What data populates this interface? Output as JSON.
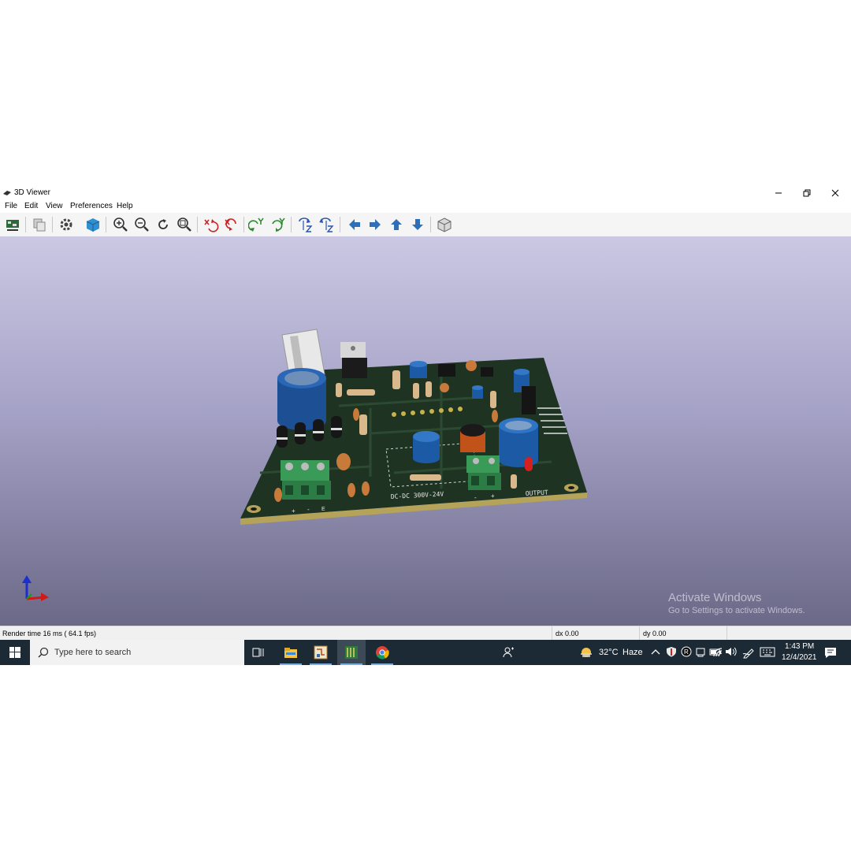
{
  "window": {
    "title": "3D Viewer",
    "menu": [
      "File",
      "Edit",
      "View",
      "Preferences",
      "Help"
    ]
  },
  "toolbar": {
    "buttons": [
      "reload-board-icon",
      "copy-image-icon",
      "settings-icon",
      "raytrace-cube-icon",
      "zoom-in-icon",
      "zoom-out-icon",
      "redraw-icon",
      "zoom-fit-icon",
      "rotate-x-cw-icon",
      "rotate-x-ccw-icon",
      "rotate-y-cw-icon",
      "rotate-y-ccw-icon",
      "rotate-z-cw-icon",
      "rotate-z-ccw-icon",
      "pan-left-icon",
      "pan-right-icon",
      "pan-up-icon",
      "pan-down-icon",
      "ortho-view-icon"
    ]
  },
  "board": {
    "silkscreen_text": "DC-DC 300V-24V",
    "output_label": "OUTPUT",
    "terminal_labels": [
      "+",
      "-",
      "E"
    ],
    "output_terminal_labels": [
      "-",
      "+"
    ]
  },
  "watermark": {
    "title": "Activate Windows",
    "subtitle": "Go to Settings to activate Windows."
  },
  "status": {
    "render_time": "Render time 16 ms ( 64.1 fps)",
    "dx": "dx 0.00",
    "dy": "dy 0.00"
  },
  "taskbar": {
    "search_placeholder": "Type here to search",
    "apps": [
      "task-view-icon",
      "file-explorer-icon",
      "kicad-pcbnew-icon",
      "kicad-3d-icon",
      "chrome-icon"
    ],
    "weather_temp": "32°C",
    "weather_desc": "Haze",
    "time": "1:43 PM",
    "date": "12/4/2021"
  },
  "colors": {
    "pcb": "#1f3323",
    "accent_blue": "#2f6fb8",
    "taskbar": "#1c2a35"
  }
}
